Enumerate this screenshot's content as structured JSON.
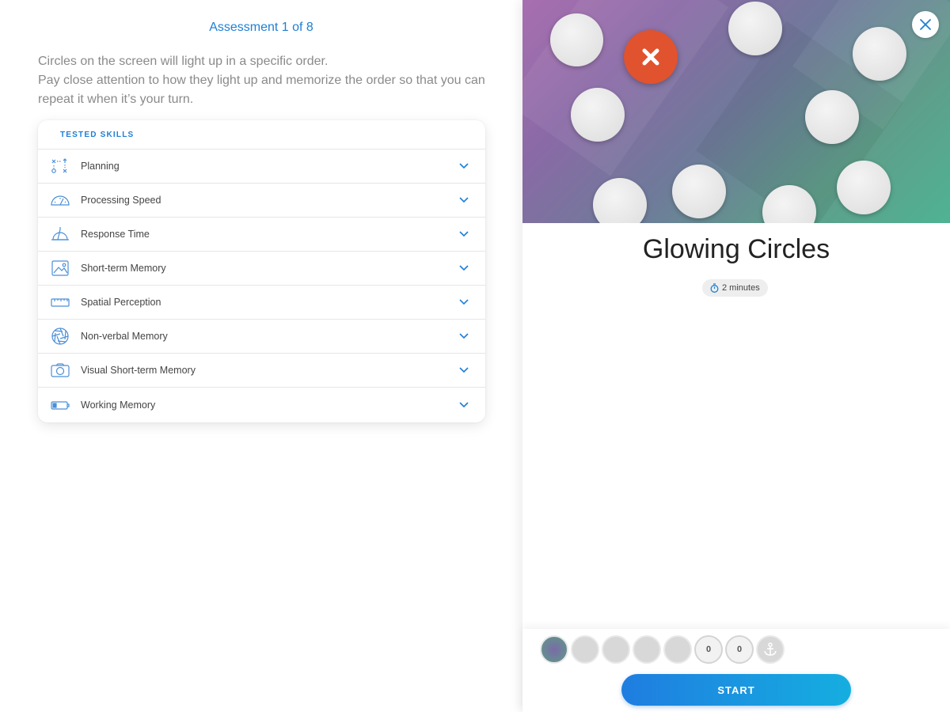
{
  "assessment": {
    "title": "Assessment 1 of 8",
    "instructions": [
      "Circles on the screen will light up in a specific order.",
      "Pay close attention to how they light up and memorize the order so that you can repeat it when it’s your turn."
    ]
  },
  "skills": {
    "header": "TESTED SKILLS",
    "items": [
      {
        "label": "Planning",
        "icon": "planning-icon"
      },
      {
        "label": "Processing Speed",
        "icon": "speedometer-icon"
      },
      {
        "label": "Response Time",
        "icon": "response-time-icon"
      },
      {
        "label": "Short-term Memory",
        "icon": "image-frame-icon"
      },
      {
        "label": "Spatial Perception",
        "icon": "ruler-icon"
      },
      {
        "label": "Non-verbal Memory",
        "icon": "aperture-icon"
      },
      {
        "label": "Visual Short-term Memory",
        "icon": "camera-icon"
      },
      {
        "label": "Working Memory",
        "icon": "battery-icon"
      }
    ]
  },
  "game": {
    "title": "Glowing Circles",
    "duration": "2 minutes"
  },
  "progress": {
    "icons": [
      {
        "name": "glowing-circles-game-icon",
        "state": "current",
        "text": ""
      },
      {
        "name": "game-2-icon",
        "state": "locked",
        "text": ""
      },
      {
        "name": "game-3-icon",
        "state": "locked",
        "text": ""
      },
      {
        "name": "game-4-icon",
        "state": "locked",
        "text": ""
      },
      {
        "name": "game-5-icon",
        "state": "locked",
        "text": ""
      },
      {
        "name": "game-6-icon",
        "state": "locked",
        "text": "0"
      },
      {
        "name": "game-7-icon",
        "state": "locked",
        "text": "0"
      },
      {
        "name": "anchor-icon",
        "state": "locked",
        "text": ""
      }
    ]
  },
  "start_button": "START",
  "colors": {
    "accent": "#1e7fd6",
    "close_badge": "#e0532e",
    "start_gradient_from": "#1f7de0",
    "start_gradient_to": "#15aee0"
  }
}
